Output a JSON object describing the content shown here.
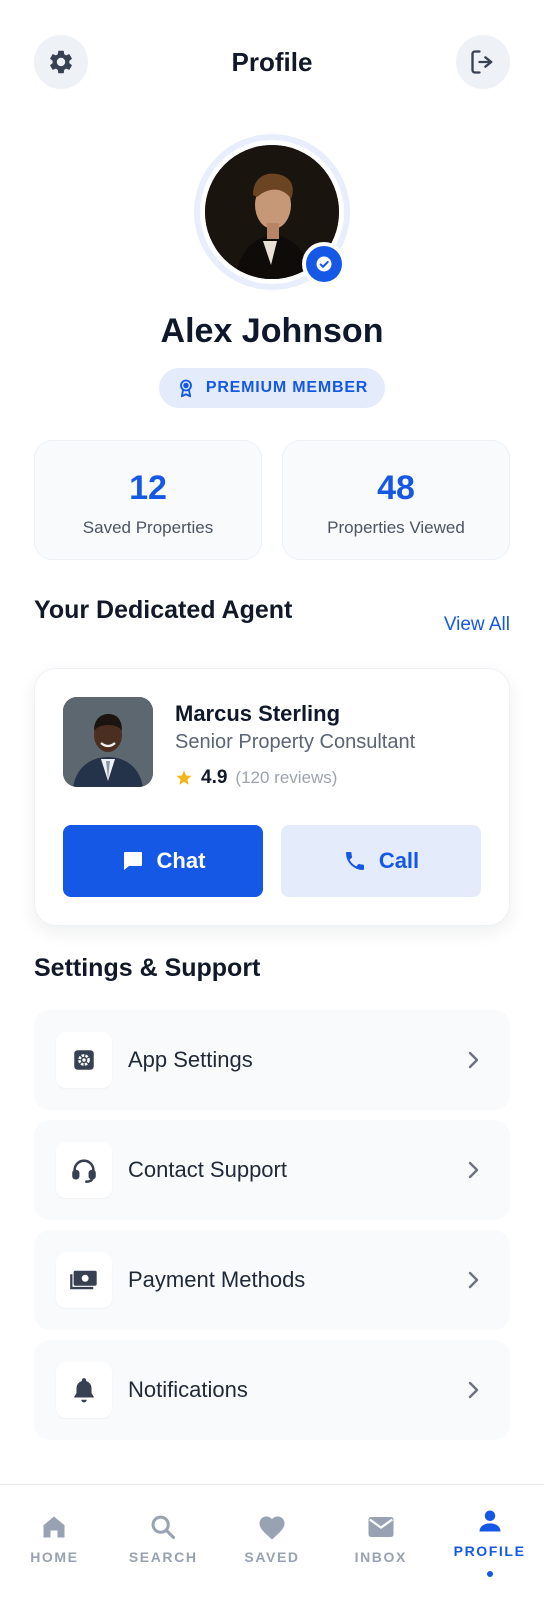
{
  "header": {
    "title": "Profile",
    "settings_icon": "gear-icon",
    "logout_icon": "logout-icon"
  },
  "profile": {
    "name": "Alex Johnson",
    "badge": "PREMIUM MEMBER",
    "verified": true
  },
  "stats": [
    {
      "value": "12",
      "label": "Saved Properties"
    },
    {
      "value": "48",
      "label": "Properties Viewed"
    }
  ],
  "agent_section": {
    "title": "Your Dedicated Agent",
    "view_all": "View All",
    "agent": {
      "name": "Marcus Sterling",
      "role": "Senior Property Consultant",
      "rating": "4.9",
      "reviews": "(120 reviews)"
    },
    "chat_label": "Chat",
    "call_label": "Call"
  },
  "settings_section": {
    "title": "Settings & Support",
    "items": [
      {
        "label": "App Settings",
        "icon": "settings-icon"
      },
      {
        "label": "Contact Support",
        "icon": "headset-icon"
      },
      {
        "label": "Payment Methods",
        "icon": "money-icon"
      },
      {
        "label": "Notifications",
        "icon": "bell-icon"
      }
    ]
  },
  "nav": {
    "items": [
      {
        "label": "HOME",
        "icon": "home-icon"
      },
      {
        "label": "SEARCH",
        "icon": "search-icon"
      },
      {
        "label": "SAVED",
        "icon": "heart-icon"
      },
      {
        "label": "INBOX",
        "icon": "mail-icon"
      },
      {
        "label": "PROFILE",
        "icon": "person-icon",
        "active": true
      }
    ]
  },
  "colors": {
    "accent": "#1558e6",
    "accent_light": "#e4ecfb",
    "muted": "#98a2b3",
    "card_bg": "#f8fafc"
  }
}
